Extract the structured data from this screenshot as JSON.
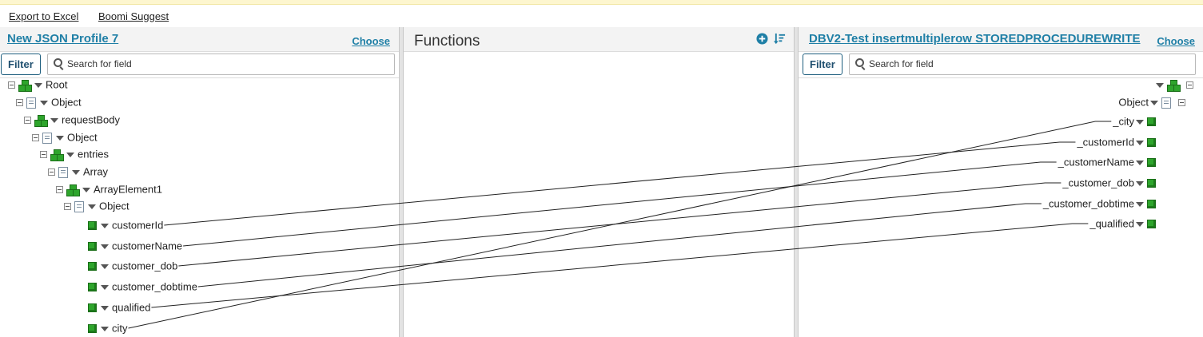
{
  "toolbar": {
    "export_label": "Export to Excel",
    "suggest_label": "Boomi Suggest"
  },
  "left": {
    "title": "New JSON Profile 7",
    "choose_label": "Choose",
    "filter_label": "Filter",
    "search_placeholder": "Search for field",
    "tree": [
      {
        "label": "Root",
        "type": "group",
        "depth": 0
      },
      {
        "label": "Object",
        "type": "object",
        "depth": 1
      },
      {
        "label": "requestBody",
        "type": "group",
        "depth": 2
      },
      {
        "label": "Object",
        "type": "object",
        "depth": 3
      },
      {
        "label": "entries",
        "type": "group",
        "depth": 4
      },
      {
        "label": "Array",
        "type": "object",
        "depth": 5
      },
      {
        "label": "ArrayElement1",
        "type": "group",
        "depth": 6
      },
      {
        "label": "Object",
        "type": "object",
        "depth": 7
      },
      {
        "label": "customerId",
        "type": "field",
        "depth": 8
      },
      {
        "label": "customerName",
        "type": "field",
        "depth": 8
      },
      {
        "label": "customer_dob",
        "type": "field",
        "depth": 8
      },
      {
        "label": "customer_dobtime",
        "type": "field",
        "depth": 8
      },
      {
        "label": "qualified",
        "type": "field",
        "depth": 8
      },
      {
        "label": "city",
        "type": "field",
        "depth": 8
      }
    ]
  },
  "functions": {
    "title": "Functions",
    "add_icon": "plus-circle-icon",
    "sort_icon": "sort-icon"
  },
  "right": {
    "title": "DBV2-Test insertmultiplerow STOREDPROCEDUREWRITE",
    "choose_label": "Choose",
    "filter_label": "Filter",
    "search_placeholder": "Search for field",
    "tree": [
      {
        "label": "",
        "type": "group"
      },
      {
        "label": "Object",
        "type": "object"
      },
      {
        "label": "_city",
        "type": "field"
      },
      {
        "label": "_customerId",
        "type": "field"
      },
      {
        "label": "_customerName",
        "type": "field"
      },
      {
        "label": "_customer_dob",
        "type": "field"
      },
      {
        "label": "_customer_dobtime",
        "type": "field"
      },
      {
        "label": "_qualified",
        "type": "field"
      }
    ]
  },
  "mappings": [
    {
      "from": "customerId",
      "to": "_customerId"
    },
    {
      "from": "customerName",
      "to": "_customerName"
    },
    {
      "from": "customer_dob",
      "to": "_customer_dob"
    },
    {
      "from": "customer_dobtime",
      "to": "_customer_dobtime"
    },
    {
      "from": "qualified",
      "to": "_qualified"
    },
    {
      "from": "city",
      "to": "_city"
    }
  ]
}
